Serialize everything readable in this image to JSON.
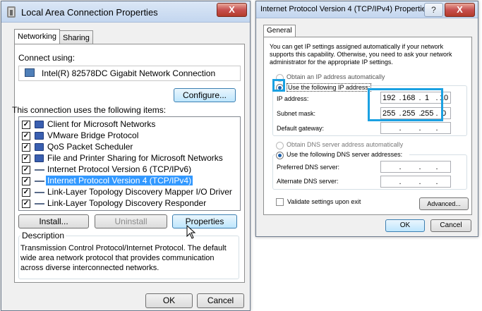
{
  "left_dialog": {
    "title": "Local Area Connection Properties",
    "close_label": "X",
    "tabs": [
      {
        "label": "Networking"
      },
      {
        "label": "Sharing"
      }
    ],
    "connect_using_label": "Connect using:",
    "adapter_name": "Intel(R) 82578DC Gigabit Network Connection",
    "configure_label": "Configure...",
    "items_label": "This connection uses the following items:",
    "items": [
      {
        "label": "Client for Microsoft Networks",
        "checked": true
      },
      {
        "label": "VMware Bridge Protocol",
        "checked": true
      },
      {
        "label": "QoS Packet Scheduler",
        "checked": true
      },
      {
        "label": "File and Printer Sharing for Microsoft Networks",
        "checked": true
      },
      {
        "label": "Internet Protocol Version 6 (TCP/IPv6)",
        "checked": true
      },
      {
        "label": "Internet Protocol Version 4 (TCP/IPv4)",
        "checked": true,
        "selected": true
      },
      {
        "label": "Link-Layer Topology Discovery Mapper I/O Driver",
        "checked": true
      },
      {
        "label": "Link-Layer Topology Discovery Responder",
        "checked": true
      }
    ],
    "install_label": "Install...",
    "uninstall_label": "Uninstall",
    "properties_label": "Properties",
    "description_label": "Description",
    "description_text": "Transmission Control Protocol/Internet Protocol. The default wide area network protocol that provides communication across diverse interconnected networks.",
    "ok_label": "OK",
    "cancel_label": "Cancel"
  },
  "right_dialog": {
    "title": "Internet Protocol Version 4 (TCP/IPv4) Properties",
    "help_label": "?",
    "close_label": "X",
    "tab_label": "General",
    "intro_text": "You can get IP settings assigned automatically if your network supports this capability. Otherwise, you need to ask your network administrator for the appropriate IP settings.",
    "obtain_ip_auto": "Obtain an IP address automatically",
    "use_following_ip": "Use the following IP address:",
    "ip_address_label": "IP address:",
    "ip_address": [
      "192",
      "168",
      "1",
      "10"
    ],
    "subnet_mask_label": "Subnet mask:",
    "subnet_mask": [
      "255",
      "255",
      "255",
      "0"
    ],
    "default_gateway_label": "Default gateway:",
    "obtain_dns_auto": "Obtain DNS server address automatically",
    "use_following_dns": "Use the following DNS server addresses:",
    "preferred_dns_label": "Preferred DNS server:",
    "alternate_dns_label": "Alternate DNS server:",
    "validate_label": "Validate settings upon exit",
    "advanced_label": "Advanced...",
    "ok_label": "OK",
    "cancel_label": "Cancel"
  },
  "colors": {
    "highlight_outline": "#1ba1e2",
    "selection": "#3399ff"
  }
}
